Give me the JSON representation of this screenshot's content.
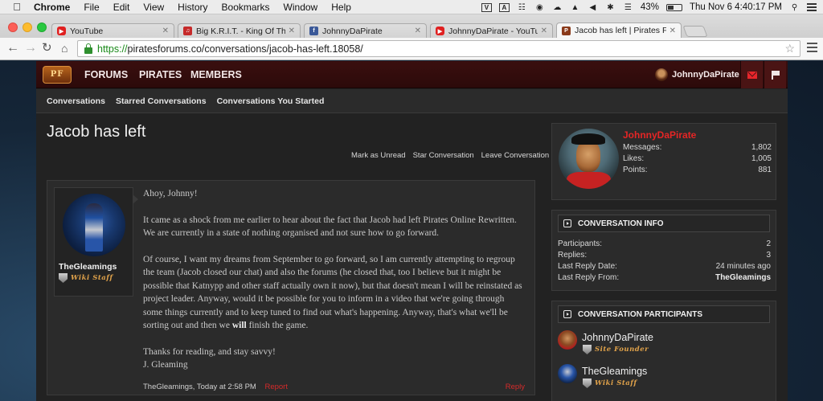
{
  "menubar": {
    "app": "Chrome",
    "items": [
      "File",
      "Edit",
      "View",
      "History",
      "Bookmarks",
      "Window",
      "Help"
    ],
    "battery": "43%",
    "clock": "Thu Nov 6  4:40:17 PM"
  },
  "tabs": [
    {
      "title": "YouTube",
      "favicon": "youtube-icon"
    },
    {
      "title": "Big K.R.I.T. - King Of The S",
      "favicon": "music-icon"
    },
    {
      "title": "JohnnyDaPirate",
      "favicon": "facebook-icon"
    },
    {
      "title": "JohnnyDaPirate - YouTube",
      "favicon": "youtube-icon"
    },
    {
      "title": "Jacob has left | Pirates For",
      "favicon": "piratesforums-icon",
      "active": true
    }
  ],
  "omnibox": {
    "scheme": "https://",
    "rest": "piratesforums.co/conversations/jacob-has-left.18058/"
  },
  "site": {
    "logo_text": "PF",
    "nav": [
      "FORUMS",
      "PIRATES",
      "MEMBERS"
    ],
    "user": "JohnnyDaPirate",
    "subnav": [
      "Conversations",
      "Starred Conversations",
      "Conversations You Started"
    ]
  },
  "conversation": {
    "title": "Jacob has left",
    "actions": [
      "Mark as Unread",
      "Star Conversation",
      "Leave Conversation"
    ]
  },
  "message": {
    "author": "TheGleamings",
    "author_badge": "Wiki Staff",
    "greeting": "Ahoy, Johnny!",
    "p1": "It came as a shock from me earlier to hear about the fact that Jacob had left Pirates Online Rewritten. We are currently in a state of nothing organised and not sure how to go forward.",
    "p2_before": "Of course, I want my dreams from September to go forward, so I am currently attempting to regroup the team (Jacob closed our chat) and also the forums (he closed that, too I believe but it might be possible that Katnypp and other staff actually own it now), but that doesn't mean I will be reinstated as project leader. Anyway, would it be possible for you to inform in a video that we're going through some things currently and to keep tuned to find out what's happening. Anyway, that's what we'll be sorting out and then we ",
    "p2_bold": "will",
    "p2_after": " finish the game.",
    "closing": "Thanks for reading, and stay savvy!",
    "signature": "J. Gleaming",
    "meta": "TheGleamings, Today at 2:58 PM",
    "report": "Report",
    "reply": "Reply"
  },
  "visitor": {
    "name": "JohnnyDaPirate",
    "stats": [
      {
        "label": "Messages:",
        "value": "1,802"
      },
      {
        "label": "Likes:",
        "value": "1,005"
      },
      {
        "label": "Points:",
        "value": "881"
      }
    ]
  },
  "info": {
    "heading": "CONVERSATION INFO",
    "rows": [
      {
        "label": "Participants:",
        "value": "2"
      },
      {
        "label": "Replies:",
        "value": "3"
      },
      {
        "label": "Last Reply Date:",
        "value": "24 minutes ago"
      },
      {
        "label": "Last Reply From:",
        "value": "TheGleamings"
      }
    ]
  },
  "participants": {
    "heading": "CONVERSATION PARTICIPANTS",
    "list": [
      {
        "name": "JohnnyDaPirate",
        "badge": "Site Founder"
      },
      {
        "name": "TheGleamings",
        "badge": "Wiki Staff"
      }
    ]
  },
  "colors": {
    "accent_red": "#e52525",
    "nav_bg": "#3a0f0f",
    "panel_bg": "#2b2b2b"
  }
}
